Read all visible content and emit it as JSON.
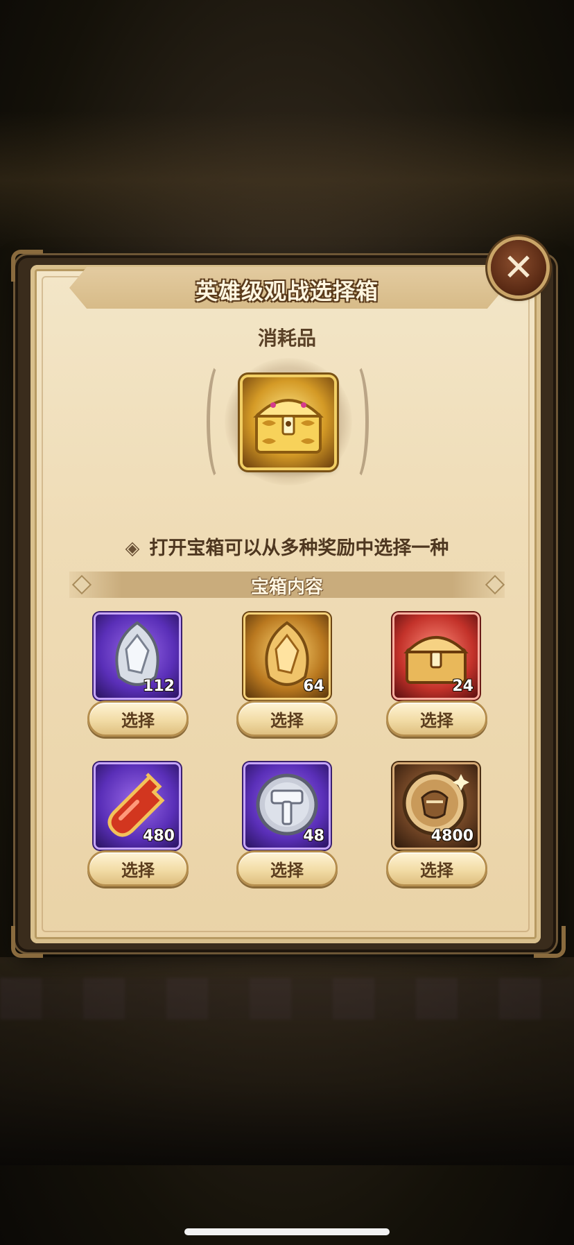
{
  "dialog": {
    "title": "英雄级观战选择箱",
    "category": "消耗品",
    "close_symbol": "✕",
    "hero_item_icon": "golden-treasure-chest",
    "description_bullet": "◈",
    "description": "打开宝箱可以从多种奖励中选择一种",
    "section_header": "宝箱内容"
  },
  "rewards": [
    {
      "icon": "silver-crystal",
      "quantity": "112",
      "frame_color": "#6a3fc9",
      "button_label": "选择"
    },
    {
      "icon": "gold-crystal",
      "quantity": "64",
      "frame_color": "#c28a2a",
      "button_label": "选择"
    },
    {
      "icon": "treasure-chest",
      "quantity": "24",
      "frame_color": "#c3322a",
      "button_label": "选择"
    },
    {
      "icon": "red-potion",
      "quantity": "480",
      "frame_color": "#6a3fc9",
      "button_label": "选择"
    },
    {
      "icon": "hammer-coin",
      "quantity": "48",
      "frame_color": "#6a3fc9",
      "button_label": "选择"
    },
    {
      "icon": "warrior-coin",
      "quantity": "4800",
      "frame_color": "#6a4022",
      "button_label": "选择"
    }
  ]
}
